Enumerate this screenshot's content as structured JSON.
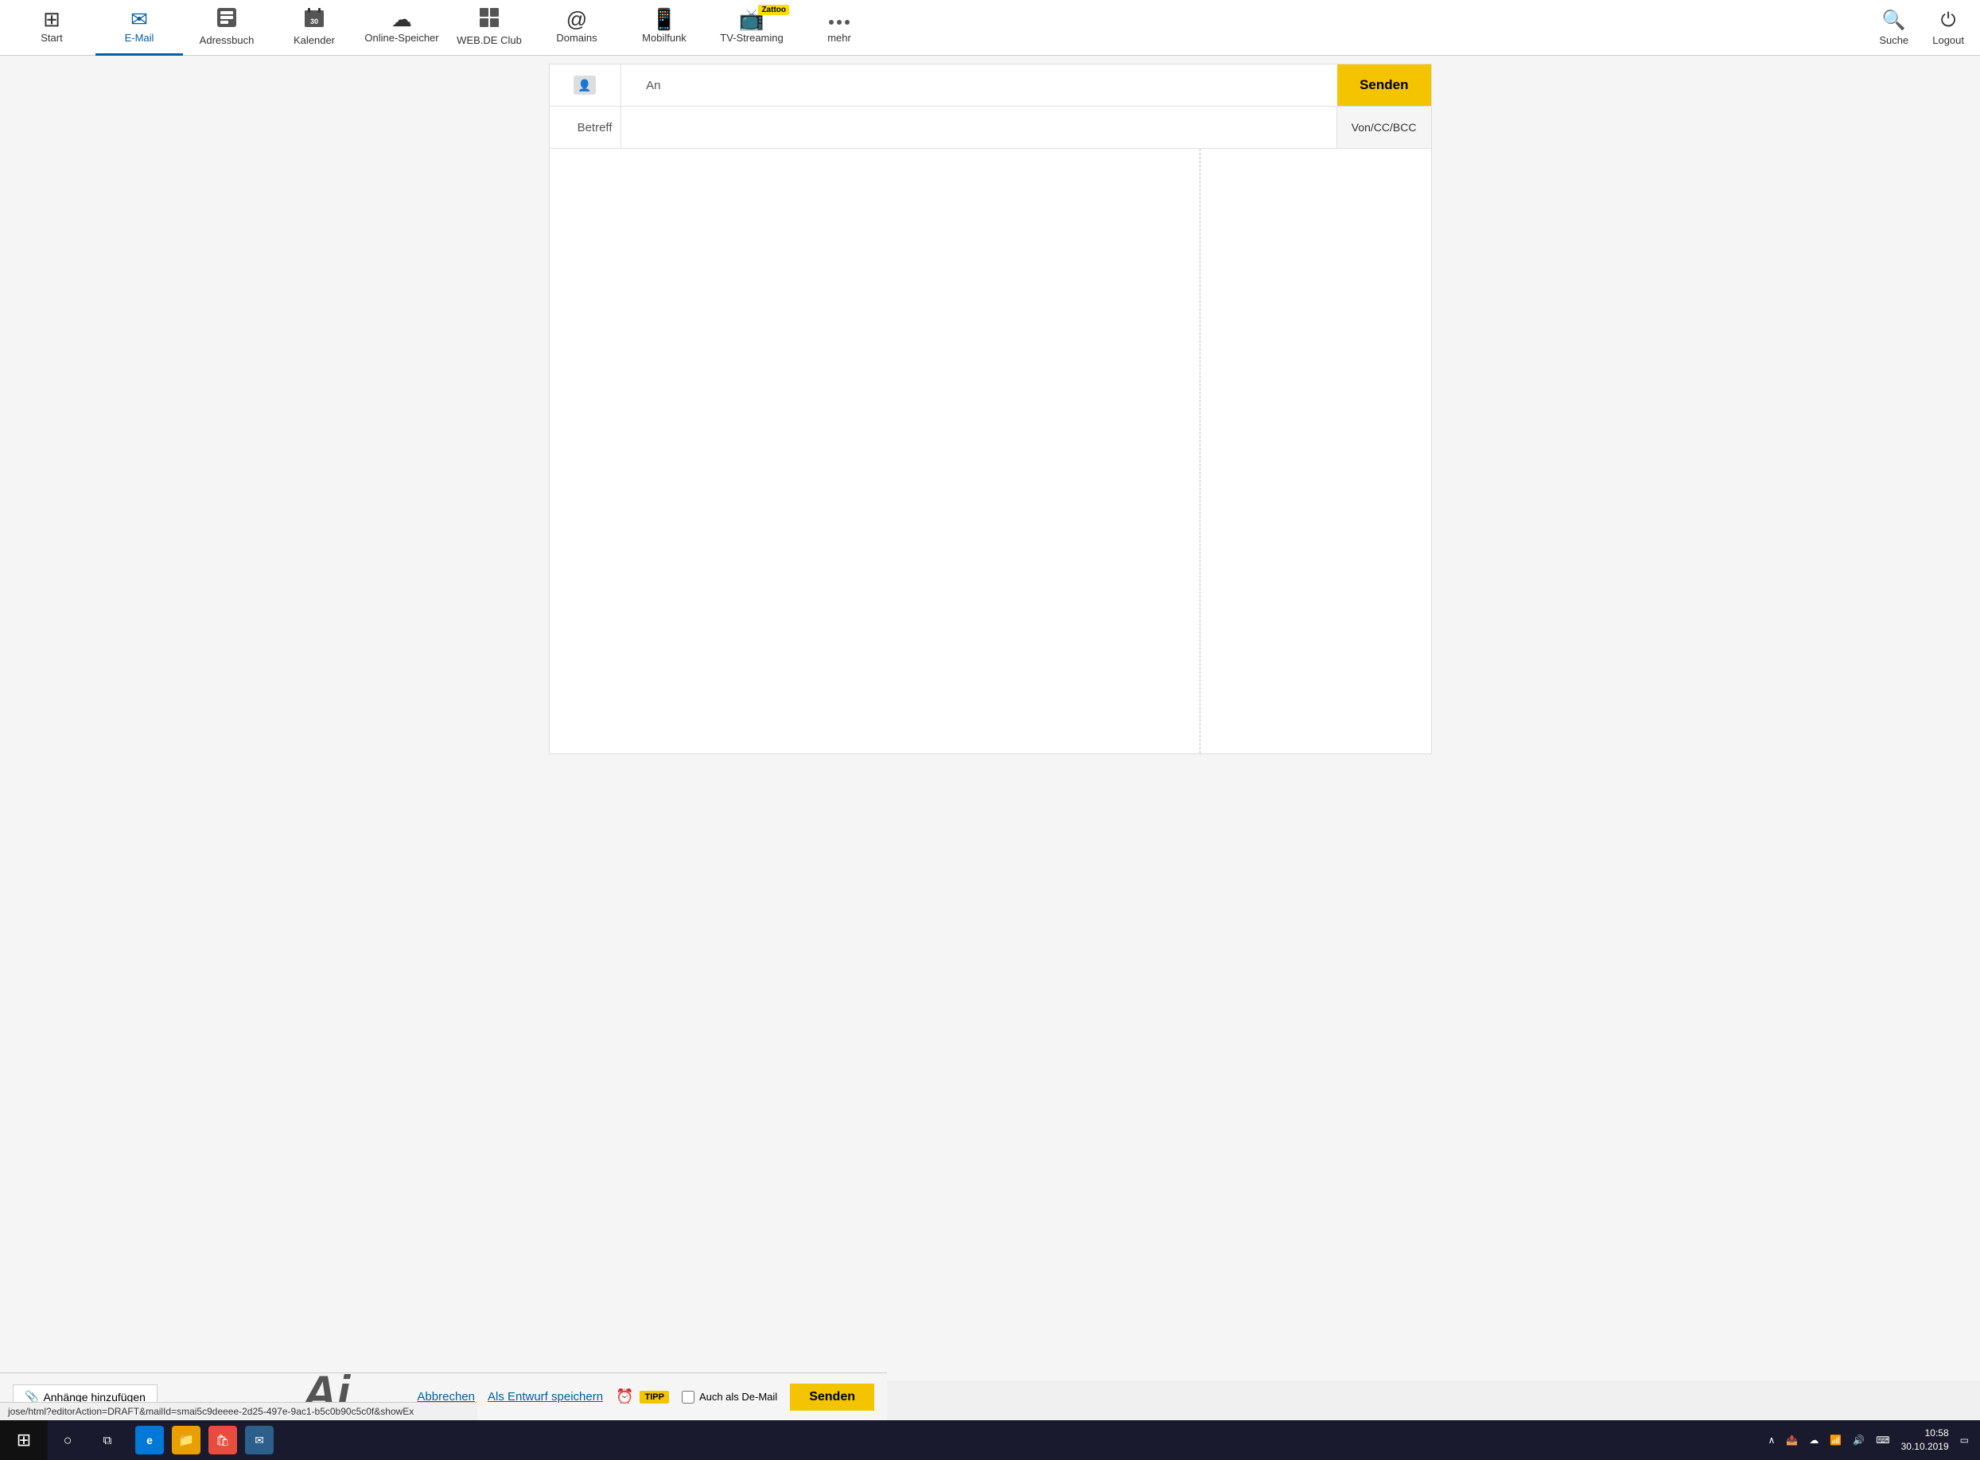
{
  "nav": {
    "items": [
      {
        "id": "start",
        "label": "Start",
        "icon": "⊞",
        "active": false
      },
      {
        "id": "email",
        "label": "E-Mail",
        "icon": "✉",
        "active": true
      },
      {
        "id": "adressbuch",
        "label": "Adressbuch",
        "icon": "👤",
        "active": false
      },
      {
        "id": "kalender",
        "label": "Kalender",
        "icon": "📅",
        "active": false
      },
      {
        "id": "online-speicher",
        "label": "Online-Speicher",
        "icon": "☁",
        "active": false
      },
      {
        "id": "webde-club",
        "label": "WEB.DE Club",
        "icon": "⊞",
        "active": false
      },
      {
        "id": "domains",
        "label": "Domains",
        "icon": "@",
        "active": false
      },
      {
        "id": "mobilfunk",
        "label": "Mobilfunk",
        "icon": "📱",
        "active": false
      },
      {
        "id": "tv-streaming",
        "label": "TV-Streaming",
        "icon": "📺",
        "active": false,
        "badge": "Zattoo"
      },
      {
        "id": "mehr",
        "label": "mehr",
        "icon": "⋯",
        "active": false
      }
    ],
    "search_label": "Suche",
    "logout_label": "Logout"
  },
  "compose": {
    "to_label": "An",
    "subject_label": "Betreff",
    "to_icon": "👤",
    "to_value": "",
    "subject_value": "",
    "send_button": "Senden",
    "vonccbcc_button": "Von/CC/BCC",
    "attach_button": "Anhänge hinzufügen",
    "cancel_button": "Abbrechen",
    "draft_button": "Als Entwurf speichern",
    "demail_label": "Auch als De-Mail",
    "send_footer_button": "Senden"
  },
  "url": "jose/html?editorAction=DRAFT&mailId=smai5c9deeee-2d25-497e-9ac1-b5c0b90c5c0f&showEx",
  "taskbar": {
    "time": "10:58",
    "date": "30.10.2019",
    "ai_text": "Ai"
  }
}
